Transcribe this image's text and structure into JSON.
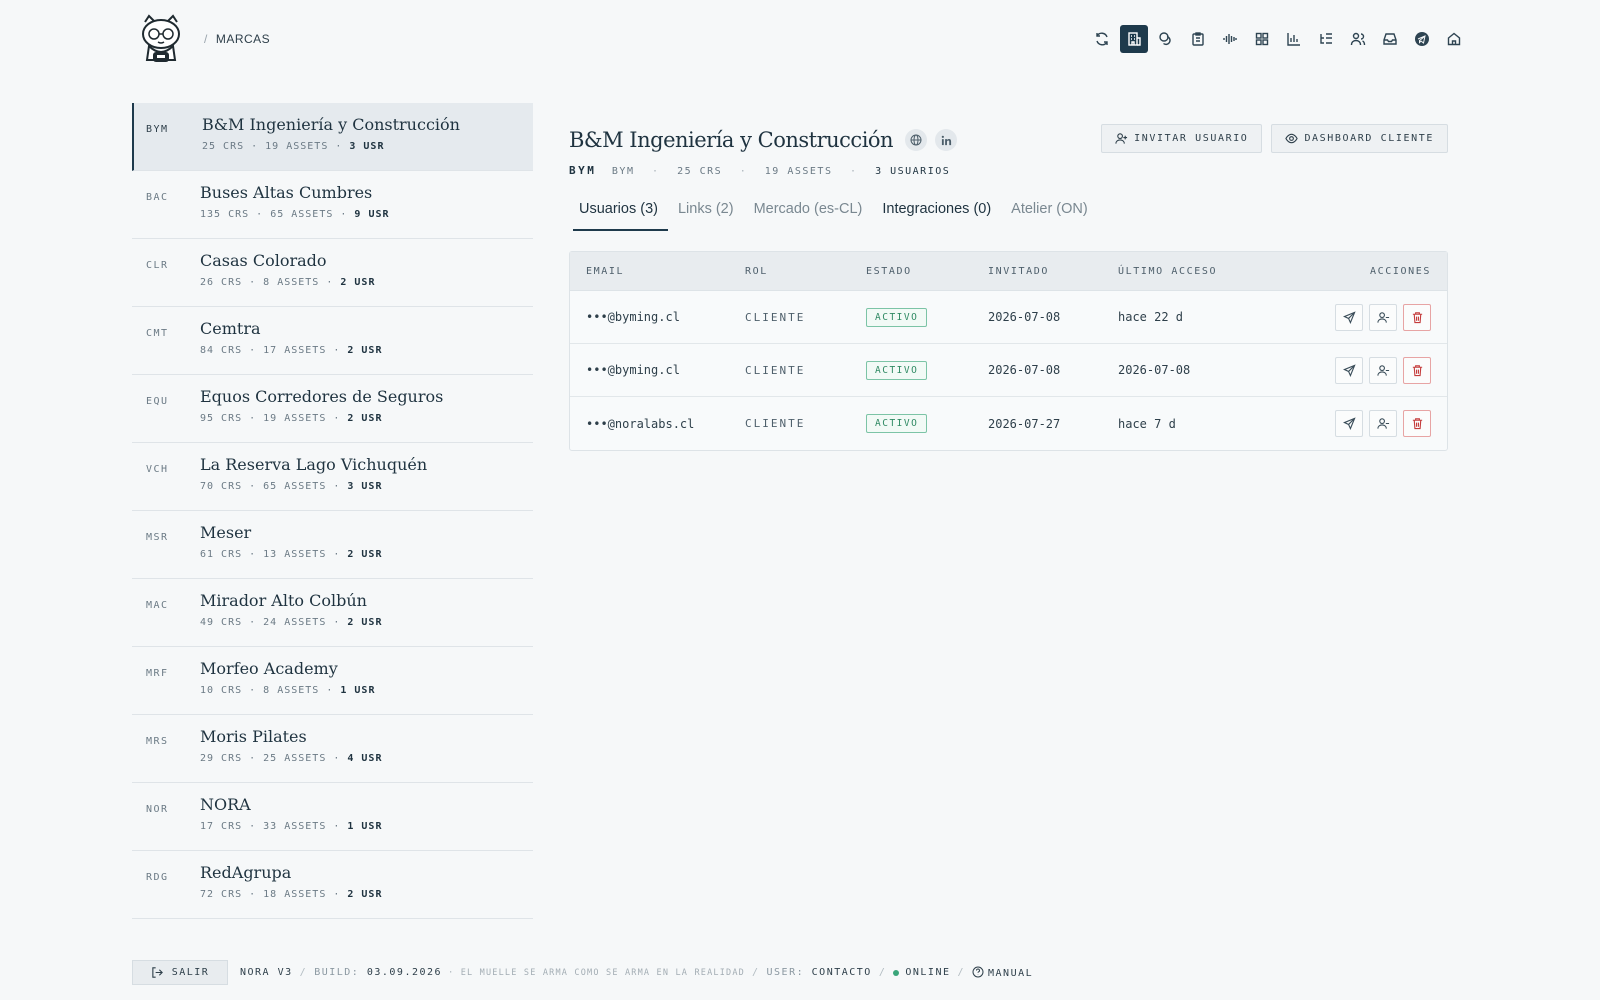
{
  "header": {
    "breadcrumb": "MARCAS",
    "nav_icons": [
      "refresh-icon",
      "building-icon",
      "coins-icon",
      "clipboard-icon",
      "audio-wave-icon",
      "grid-icon",
      "bar-chart-icon",
      "list-tree-icon",
      "users-icon",
      "inbox-icon",
      "telegram-icon",
      "home-icon"
    ],
    "active_icon": "building-icon"
  },
  "brands": [
    {
      "code": "BYM",
      "name": "B&M Ingeniería y Construcción",
      "crs": "25 CRS",
      "assets": "19 ASSETS",
      "usr": "3 USR",
      "active": true
    },
    {
      "code": "BAC",
      "name": "Buses Altas Cumbres",
      "crs": "135 CRS",
      "assets": "65 ASSETS",
      "usr": "9 USR"
    },
    {
      "code": "CLR",
      "name": "Casas Colorado",
      "crs": "26 CRS",
      "assets": "8 ASSETS",
      "usr": "2 USR"
    },
    {
      "code": "CMT",
      "name": "Cemtra",
      "crs": "84 CRS",
      "assets": "17 ASSETS",
      "usr": "2 USR"
    },
    {
      "code": "EQU",
      "name": "Equos Corredores de Seguros",
      "crs": "95 CRS",
      "assets": "19 ASSETS",
      "usr": "2 USR"
    },
    {
      "code": "VCH",
      "name": "La Reserva Lago Vichuquén",
      "crs": "70 CRS",
      "assets": "65 ASSETS",
      "usr": "3 USR"
    },
    {
      "code": "MSR",
      "name": "Meser",
      "crs": "61 CRS",
      "assets": "13 ASSETS",
      "usr": "2 USR"
    },
    {
      "code": "MAC",
      "name": "Mirador Alto Colbún",
      "crs": "49 CRS",
      "assets": "24 ASSETS",
      "usr": "2 USR"
    },
    {
      "code": "MRF",
      "name": "Morfeo Academy",
      "crs": "10 CRS",
      "assets": "8 ASSETS",
      "usr": "1 USR"
    },
    {
      "code": "MRS",
      "name": "Moris Pilates",
      "crs": "29 CRS",
      "assets": "25 ASSETS",
      "usr": "4 USR"
    },
    {
      "code": "NOR",
      "name": "NORA",
      "crs": "17 CRS",
      "assets": "33 ASSETS",
      "usr": "1 USR"
    },
    {
      "code": "RDG",
      "name": "RedAgrupa",
      "crs": "72 CRS",
      "assets": "18 ASSETS",
      "usr": "2 USR"
    }
  ],
  "detail": {
    "title": "B&M Ingeniería y Construcción",
    "code": "BYM",
    "sub_code": "BYM",
    "crs": "25 CRS",
    "assets": "19 ASSETS",
    "users": "3 USUARIOS",
    "invite_label": "INVITAR USUARIO",
    "dashboard_label": "DASHBOARD CLIENTE",
    "tabs": [
      {
        "label": "Usuarios (3)",
        "active": true
      },
      {
        "label": "Links (2)"
      },
      {
        "label": "Mercado (es-CL)"
      },
      {
        "label": "Integraciones (0)",
        "strong": true
      },
      {
        "label": "Atelier (ON)"
      }
    ]
  },
  "table": {
    "headers": {
      "email": "EMAIL",
      "rol": "ROL",
      "estado": "ESTADO",
      "invitado": "INVITADO",
      "acceso": "ÚLTIMO ACCESO",
      "acciones": "ACCIONES"
    },
    "rows": [
      {
        "email": "•••@byming.cl",
        "rol": "CLIENTE",
        "estado": "ACTIVO",
        "invitado": "2026-07-08",
        "acceso": "hace 22 d"
      },
      {
        "email": "•••@byming.cl",
        "rol": "CLIENTE",
        "estado": "ACTIVO",
        "invitado": "2026-07-08",
        "acceso": "2026-07-08"
      },
      {
        "email": "•••@noralabs.cl",
        "rol": "CLIENTE",
        "estado": "ACTIVO",
        "invitado": "2026-07-27",
        "acceso": "hace 7 d"
      }
    ]
  },
  "footer": {
    "logout": "SALIR",
    "version": "NORA V3",
    "build_label": "BUILD:",
    "build_value": "03.09.2026",
    "tagline": "· EL MUELLE SE ARMA COMO SE ARMA EN LA REALIDAD",
    "user_label": "USER:",
    "user_value": "CONTACTO",
    "status": "ONLINE",
    "manual": "MANUAL"
  },
  "colors": {
    "accent": "#1e3a4c",
    "success": "#2f8a63",
    "danger": "#c43b3b"
  }
}
